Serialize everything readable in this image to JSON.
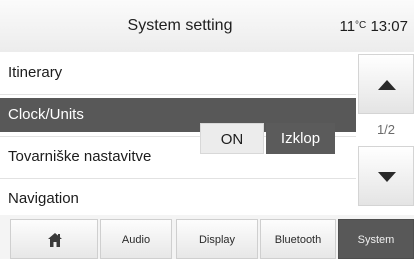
{
  "header": {
    "title": "System setting",
    "temperature_value": "11",
    "temperature_unit": "°C",
    "time": "13:07"
  },
  "menu": {
    "items": [
      {
        "label": "Itinerary"
      },
      {
        "label": "Clock/Units",
        "selected": true
      },
      {
        "label": "Tovarniške nastavitve"
      },
      {
        "label": "Navigation"
      }
    ],
    "navigation_toggle": {
      "on_label": "ON",
      "off_label": "Izklop",
      "value": "Izklop"
    }
  },
  "scroll": {
    "page_indicator": "1/2",
    "up_icon": "triangle-up-icon",
    "down_icon": "triangle-down-icon"
  },
  "tabs": [
    {
      "label": "",
      "icon": "home-icon"
    },
    {
      "label": "Audio"
    },
    {
      "label": "Display"
    },
    {
      "label": "Bluetooth"
    },
    {
      "label": "System",
      "active": true
    }
  ],
  "colors": {
    "selected_bg": "#585858",
    "selected_text": "#ffffff",
    "toggle_on_bg": "#ececec",
    "toggle_off_bg": "#5b5b5b"
  }
}
